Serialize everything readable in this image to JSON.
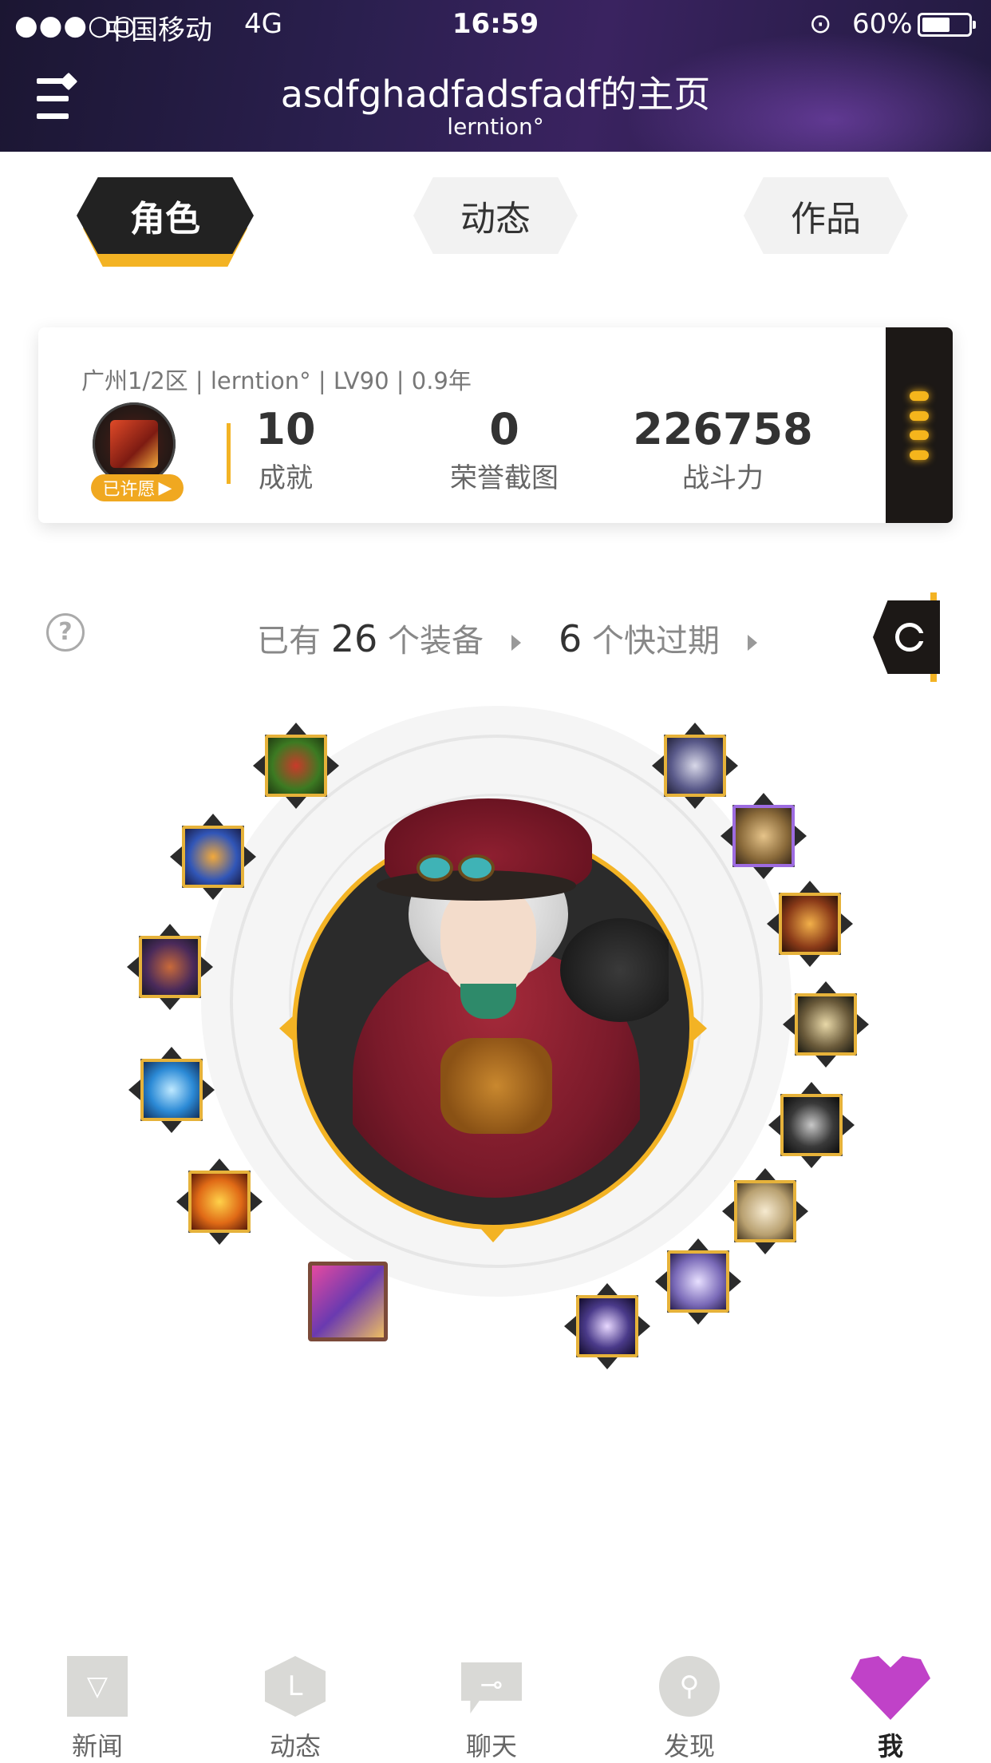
{
  "status_bar": {
    "signal": "●●●○○",
    "carrier": "中国移动",
    "network": "4G",
    "time": "16:59",
    "battery_percent": "60%",
    "battery_level": 0.6
  },
  "header": {
    "title": "asdfghadfadsfadf的主页",
    "subtitle": "lerntion°"
  },
  "tabs": [
    {
      "label": "角色",
      "active": true
    },
    {
      "label": "动态",
      "active": false
    },
    {
      "label": "作品",
      "active": false
    }
  ],
  "profile_card": {
    "meta": "广州1/2区 | lerntion° | LV90 | 0.9年",
    "wish_badge": "已许愿",
    "stats": [
      {
        "value": "10",
        "label": "成就"
      },
      {
        "value": "0",
        "label": "荣誉截图"
      },
      {
        "value": "226758",
        "label": "战斗力"
      }
    ]
  },
  "equipment_summary": {
    "owned_prefix": "已有",
    "owned_count": "26",
    "owned_suffix": "个装备",
    "expiring_count": "6",
    "expiring_suffix": "个快过期"
  },
  "colors": {
    "accent": "#f3b324",
    "dark": "#222222",
    "active_nav": "#c042c8"
  },
  "bottom_nav": [
    {
      "label": "新闻",
      "icon": "news-icon"
    },
    {
      "label": "动态",
      "icon": "feed-icon"
    },
    {
      "label": "聊天",
      "icon": "chat-icon"
    },
    {
      "label": "发现",
      "icon": "discover-icon"
    },
    {
      "label": "我",
      "icon": "me-heart-icon",
      "active": true
    }
  ]
}
